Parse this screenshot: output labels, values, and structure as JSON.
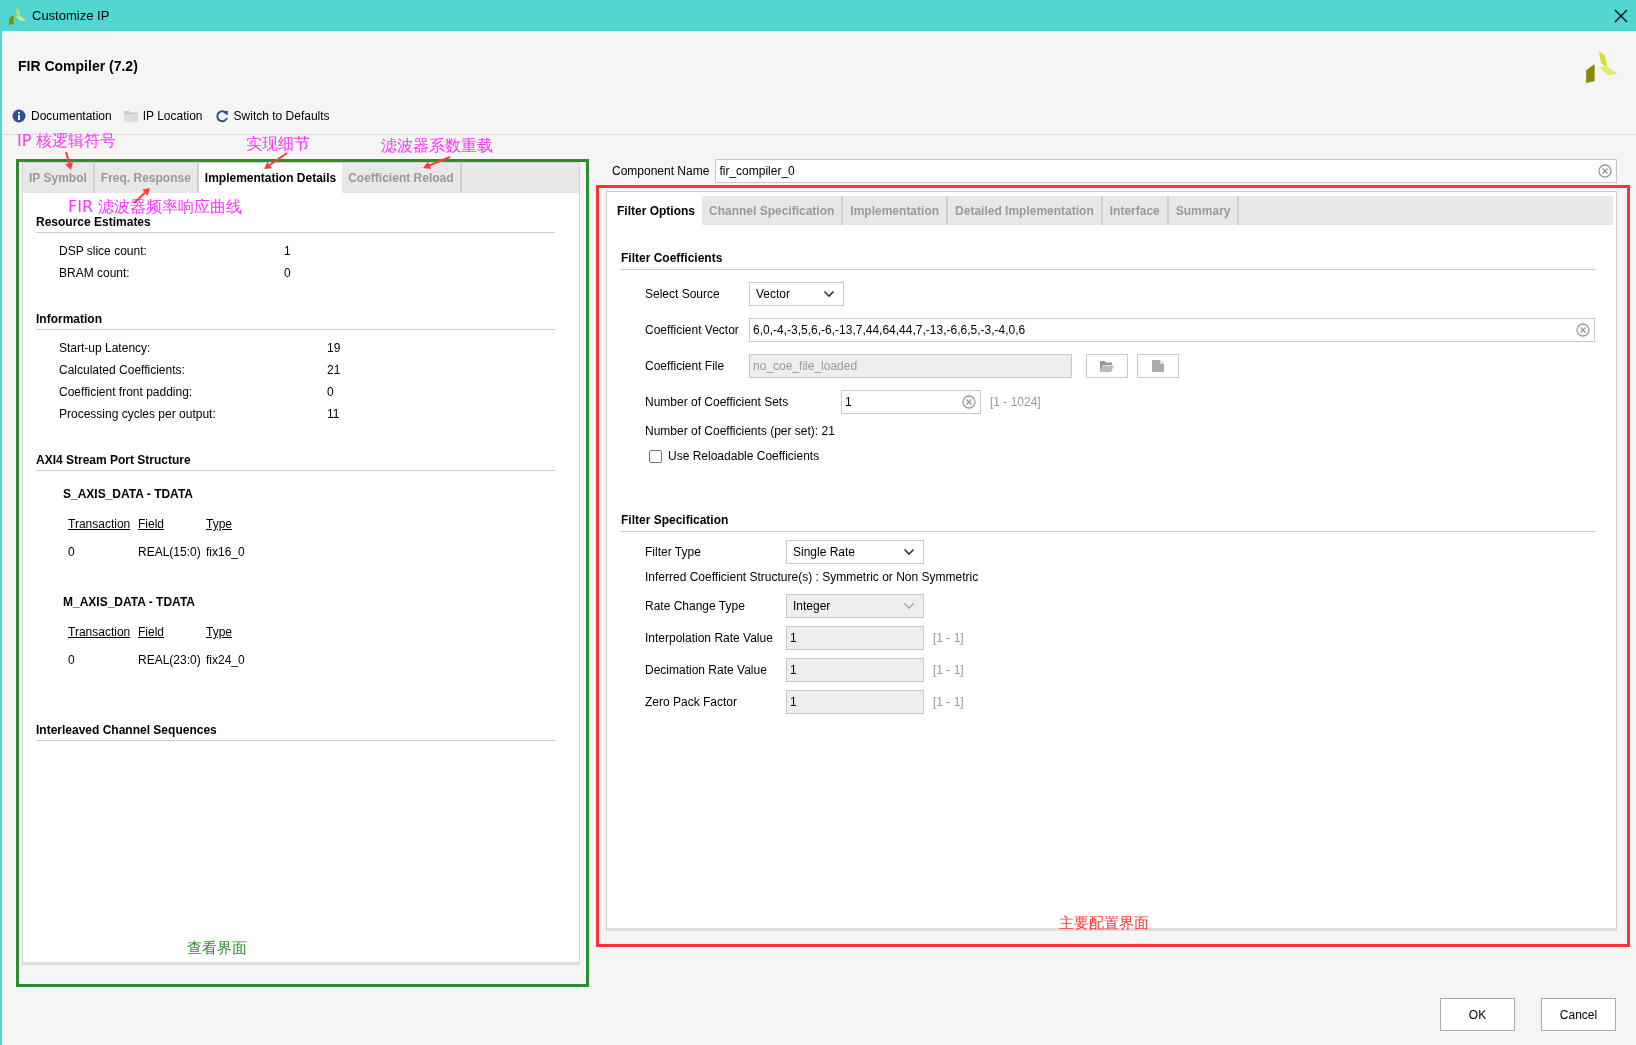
{
  "window": {
    "title": "Customize IP"
  },
  "header": {
    "title": "FIR Compiler (7.2)"
  },
  "toolbar": [
    {
      "label": "Documentation",
      "kind": "info"
    },
    {
      "label": "IP Location",
      "kind": "folder"
    },
    {
      "label": "Switch to Defaults",
      "kind": "refresh"
    }
  ],
  "left_panel": {
    "tabs": [
      {
        "label": "IP Symbol",
        "selected": false
      },
      {
        "label": "Freq. Response",
        "selected": false
      },
      {
        "label": "Implementation Details",
        "selected": true
      },
      {
        "label": "Coefficient Reload",
        "selected": false
      }
    ],
    "sections": [
      {
        "title": "Resource Estimates",
        "kind": "pairs",
        "rows": [
          {
            "label": "DSP slice count:",
            "value": "1"
          },
          {
            "label": "BRAM count:",
            "value": "0"
          }
        ]
      },
      {
        "title": "Information",
        "kind": "pairs",
        "rows": [
          {
            "label": "Start-up Latency:",
            "value": "19"
          },
          {
            "label": "Calculated Coefficients:",
            "value": "21"
          },
          {
            "label": "Coefficient front padding:",
            "value": "0"
          },
          {
            "label": "Processing cycles per output:",
            "value": "11"
          }
        ]
      },
      {
        "title": "AXI4 Stream Port Structure",
        "kind": "ports",
        "ports": [
          {
            "name": "S_AXIS_DATA - TDATA",
            "columns": [
              "Transaction",
              "Field",
              "Type"
            ],
            "rows": [
              [
                "0",
                "REAL(15:0)",
                "fix16_0"
              ]
            ]
          },
          {
            "name": "M_AXIS_DATA - TDATA",
            "columns": [
              "Transaction",
              "Field",
              "Type"
            ],
            "rows": [
              [
                "0",
                "REAL(23:0)",
                "fix24_0"
              ]
            ]
          }
        ]
      },
      {
        "title": "Interleaved Channel Sequences",
        "kind": "empty"
      }
    ]
  },
  "component_name": {
    "label": "Component Name",
    "value": "fir_compiler_0"
  },
  "config": {
    "tabs": [
      {
        "label": "Filter Options",
        "selected": true
      },
      {
        "label": "Channel Specification",
        "selected": false
      },
      {
        "label": "Implementation",
        "selected": false
      },
      {
        "label": "Detailed Implementation",
        "selected": false
      },
      {
        "label": "Interface",
        "selected": false
      },
      {
        "label": "Summary",
        "selected": false
      }
    ],
    "sections": [
      {
        "title": "Filter Coefficients",
        "rows": [
          {
            "kind": "select",
            "label": "Select Source",
            "value": "Vector",
            "disabled": false
          },
          {
            "kind": "text",
            "label": "Coefficient Vector",
            "value": "6,0,-4,-3,5,6,-6,-13,7,44,64,44,7,-13,-6,6,5,-3,-4,0,6",
            "disabled": false,
            "clearable": true
          },
          {
            "kind": "file",
            "label": "Coefficient File",
            "value": "no_coe_file_loaded",
            "disabled": true
          },
          {
            "kind": "text",
            "label": "Number of Coefficient Sets",
            "value": "1",
            "disabled": false,
            "clearable": true,
            "range": "[1 - 1024]"
          },
          {
            "kind": "info",
            "text": "Number of Coefficients (per set): 21"
          },
          {
            "kind": "checkbox",
            "label": "Use Reloadable Coefficients",
            "checked": false
          }
        ]
      },
      {
        "title": "Filter Specification",
        "rows": [
          {
            "kind": "select",
            "label": "Filter Type",
            "value": "Single Rate",
            "disabled": false
          },
          {
            "kind": "info",
            "text": "Inferred Coefficient Structure(s) : Symmetric or Non Symmetric"
          },
          {
            "kind": "select",
            "label": "Rate Change Type",
            "value": "Integer",
            "disabled": true
          },
          {
            "kind": "text",
            "label": "Interpolation Rate Value",
            "value": "1",
            "disabled": true,
            "range": "[1 - 1]"
          },
          {
            "kind": "text",
            "label": "Decimation Rate Value",
            "value": "1",
            "disabled": true,
            "range": "[1 - 1]"
          },
          {
            "kind": "text",
            "label": "Zero Pack Factor",
            "value": "1",
            "disabled": true,
            "range": "[1 - 1]"
          }
        ]
      }
    ]
  },
  "buttons": [
    "OK",
    "Cancel"
  ],
  "annotations": {
    "labels": [
      "IP 核逻辑符号",
      "实现细节",
      "滤波器系数重载",
      "FIR 滤波器频率响应曲线"
    ],
    "regions": [
      {
        "label": "查看界面",
        "color": "#2e8b2e"
      },
      {
        "label": "主要配置界面",
        "color": "#ff3333"
      }
    ]
  }
}
